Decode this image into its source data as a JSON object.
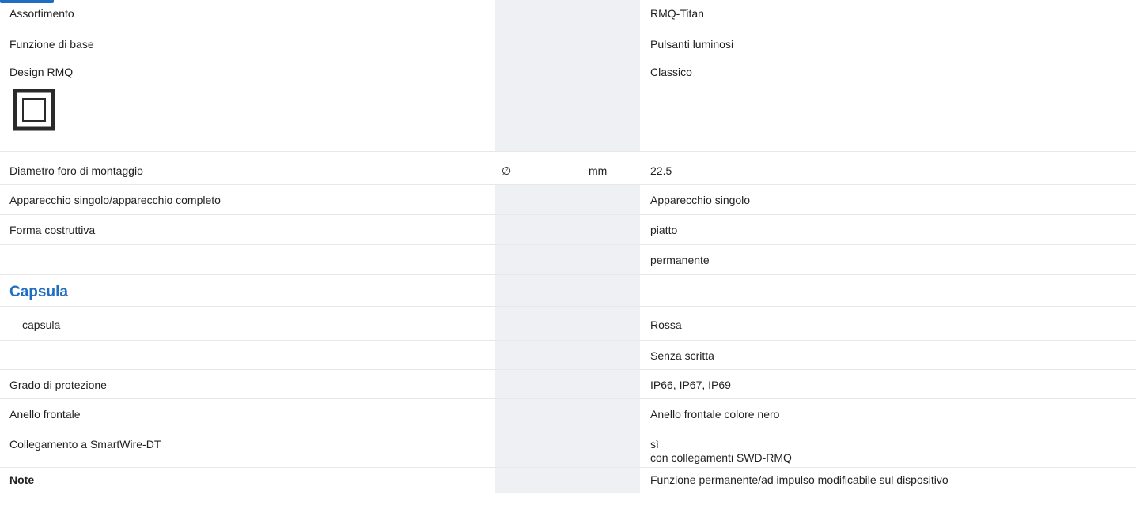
{
  "colors": {
    "accent": "#1f6ec2",
    "shade": "#eef0f3",
    "border": "#e6e8eb",
    "text": "#222222"
  },
  "rows": [
    {
      "label": "Assortimento",
      "symbol": "",
      "unit": "",
      "value": "RMQ-Titan"
    },
    {
      "label": "Funzione di base",
      "symbol": "",
      "unit": "",
      "value": "Pulsanti luminosi"
    },
    {
      "label": "Design RMQ",
      "symbol": "",
      "unit": "",
      "value": "Classico",
      "icon": "rmq-classic-design-icon"
    },
    {
      "label": "Diametro foro di montaggio",
      "symbol": "∅",
      "unit": "mm",
      "value": "22.5"
    },
    {
      "label": "Apparecchio singolo/apparecchio completo",
      "symbol": "",
      "unit": "",
      "value": "Apparecchio singolo"
    },
    {
      "label": "Forma costruttiva",
      "symbol": "",
      "unit": "",
      "value": "piatto"
    },
    {
      "label": "",
      "symbol": "",
      "unit": "",
      "value": "permanente"
    }
  ],
  "section": {
    "title": "Capsula",
    "rows": [
      {
        "label": "capsula",
        "symbol": "",
        "unit": "",
        "value": "Rossa"
      },
      {
        "label": "",
        "symbol": "",
        "unit": "",
        "value": "Senza scritta"
      },
      {
        "label": "Grado di protezione",
        "symbol": "",
        "unit": "",
        "value": "IP66, IP67, IP69"
      },
      {
        "label": "Anello frontale",
        "symbol": "",
        "unit": "",
        "value": "Anello frontale colore nero"
      },
      {
        "label": "Collegamento a SmartWire-DT",
        "symbol": "",
        "unit": "",
        "value": "sì",
        "value2": "con collegamenti SWD-RMQ"
      }
    ]
  },
  "note": {
    "label": "Note",
    "value": "Funzione permanente/ad impulso modificabile sul dispositivo"
  }
}
